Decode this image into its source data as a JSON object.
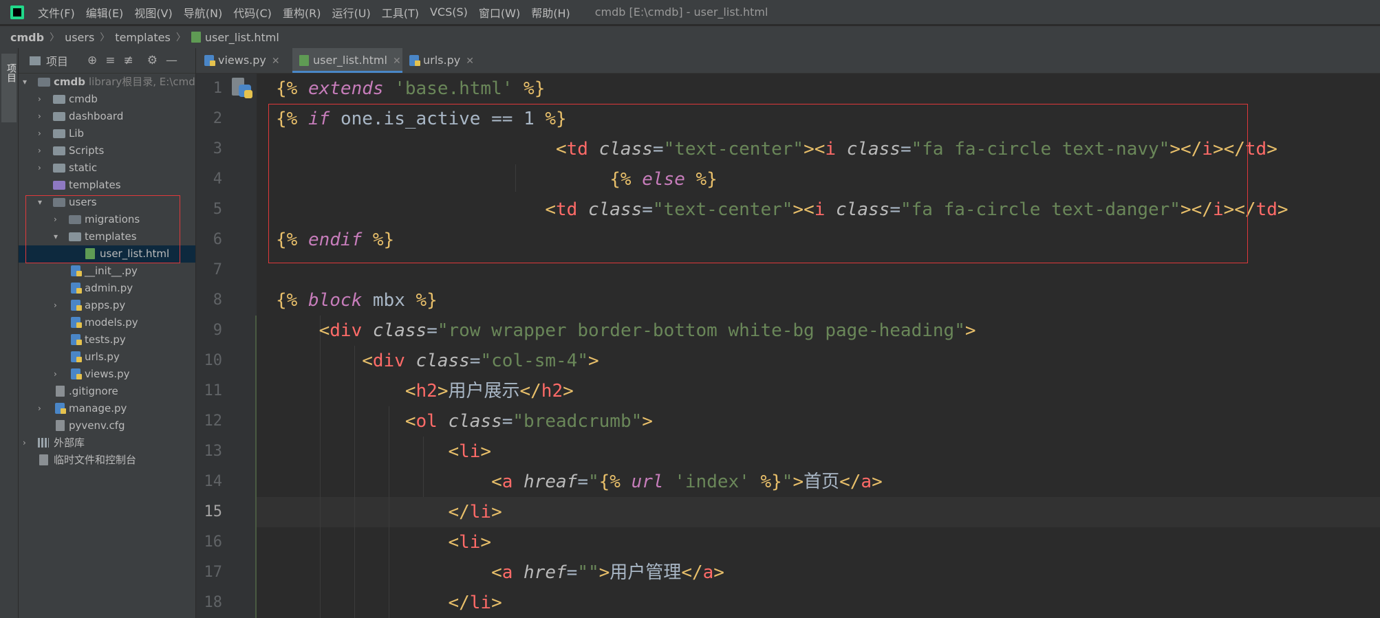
{
  "menu": [
    "文件(F)",
    "编辑(E)",
    "视图(V)",
    "导航(N)",
    "代码(C)",
    "重构(R)",
    "运行(U)",
    "工具(T)",
    "VCS(S)",
    "窗口(W)",
    "帮助(H)"
  ],
  "window_title": "cmdb [E:\\cmdb] - user_list.html",
  "breadcrumb": [
    "cmdb",
    "users",
    "templates",
    "user_list.html"
  ],
  "side_strip_label": "项目",
  "project_panel": {
    "title": "项目"
  },
  "tree": [
    {
      "label": "cmdb",
      "extra": "library根目录, E:\\cmdb",
      "bold": true
    },
    {
      "label": "cmdb"
    },
    {
      "label": "dashboard"
    },
    {
      "label": "Lib"
    },
    {
      "label": "Scripts"
    },
    {
      "label": "static"
    },
    {
      "label": "templates"
    },
    {
      "label": "users"
    },
    {
      "label": "migrations"
    },
    {
      "label": "templates"
    },
    {
      "label": "user_list.html"
    },
    {
      "label": "__init__.py"
    },
    {
      "label": "admin.py"
    },
    {
      "label": "apps.py"
    },
    {
      "label": "models.py"
    },
    {
      "label": "tests.py"
    },
    {
      "label": "urls.py"
    },
    {
      "label": "views.py"
    },
    {
      "label": ".gitignore"
    },
    {
      "label": "manage.py"
    },
    {
      "label": "pyvenv.cfg"
    },
    {
      "label": "外部库"
    },
    {
      "label": "临时文件和控制台"
    }
  ],
  "tabs": [
    {
      "label": "views.py",
      "active": false
    },
    {
      "label": "user_list.html",
      "active": true
    },
    {
      "label": "urls.py",
      "active": false
    }
  ],
  "editor": {
    "current_line": 15,
    "line_numbers": [
      "1",
      "2",
      "3",
      "4",
      "5",
      "6",
      "7",
      "8",
      "9",
      "10",
      "11",
      "12",
      "13",
      "14",
      "15",
      "16",
      "17",
      "18"
    ],
    "lines": [
      "{% extends 'base.html' %}",
      "{% if one.is_active == 1 %}",
      "                          <td class=\"text-center\"><i class=\"fa fa-circle text-navy\"></i></td>",
      "                               {% else %}",
      "                         <td class=\"text-center\"><i class=\"fa fa-circle text-danger\"></i></td>",
      "{% endif %}",
      "",
      "{% block mbx %}",
      "    <div class=\"row wrapper border-bottom white-bg page-heading\">",
      "        <div class=\"col-sm-4\">",
      "            <h2>用户展示</h2>",
      "            <ol class=\"breadcrumb\">",
      "                <li>",
      "                    <a hreaf=\"{% url 'index' %}\">首页</a>",
      "                </li>",
      "                <li>",
      "                    <a href=\"\">用户管理</a>",
      "                </li>"
    ]
  },
  "colors": {
    "highlight_box": "#e0393b",
    "active_tab_underline": "#4a88c7",
    "template_keyword": "#c77dbb",
    "string": "#6a8759",
    "tag": "#e8bf6a"
  }
}
